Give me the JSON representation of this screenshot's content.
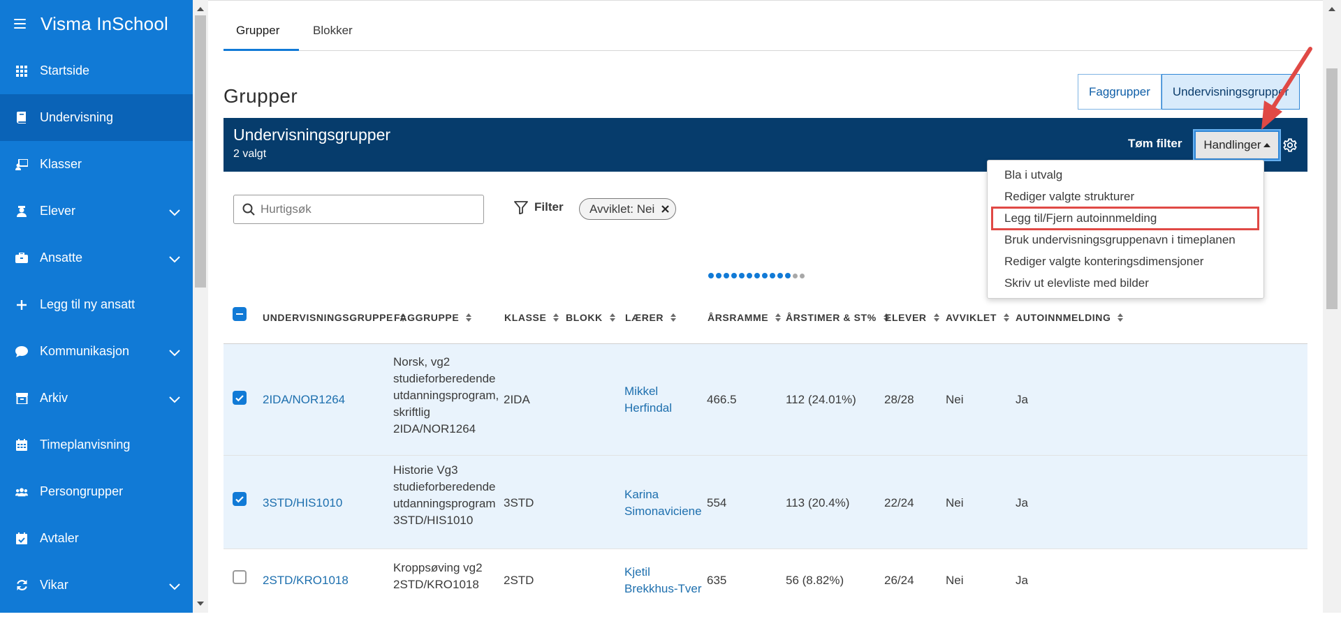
{
  "app": {
    "title": "Visma InSchool"
  },
  "sidebar": {
    "items": [
      {
        "label": "Startside",
        "icon": "grid-icon"
      },
      {
        "label": "Undervisning",
        "icon": "book-icon",
        "active": true
      },
      {
        "label": "Klasser",
        "icon": "classroom-icon"
      },
      {
        "label": "Elever",
        "icon": "student-icon",
        "expandable": true
      },
      {
        "label": "Ansatte",
        "icon": "briefcase-icon",
        "expandable": true
      },
      {
        "label": "Legg til ny ansatt",
        "icon": "plus-icon"
      },
      {
        "label": "Kommunikasjon",
        "icon": "chat-icon",
        "expandable": true
      },
      {
        "label": "Arkiv",
        "icon": "archive-icon",
        "expandable": true
      },
      {
        "label": "Timeplanvisning",
        "icon": "calendar-icon"
      },
      {
        "label": "Persongrupper",
        "icon": "people-icon"
      },
      {
        "label": "Avtaler",
        "icon": "calendar-check-icon"
      },
      {
        "label": "Vikar",
        "icon": "refresh-icon",
        "expandable": true
      }
    ]
  },
  "tabs": [
    {
      "label": "Grupper",
      "active": true
    },
    {
      "label": "Blokker"
    }
  ],
  "page": {
    "title": "Grupper"
  },
  "segmented": {
    "option1": "Faggrupper",
    "option2": "Undervisningsgrupper",
    "selected": "Undervisningsgrupper"
  },
  "grid": {
    "title": "Undervisningsgrupper",
    "subtitle": "2 valgt",
    "clear_filter": "Tøm filter",
    "actions": "Handlinger",
    "search_placeholder": "Hurtigsøk",
    "filter_label": "Filter",
    "chip": "Avviklet: Nei",
    "columns": [
      "UNDERVISNINGSGRUPPE",
      "FAGGRUPPE",
      "KLASSE",
      "BLOKK",
      "LÆRER",
      "ÅRSRAMME",
      "ÅRSTIMER & ST%",
      "ELEVER",
      "AVVIKLET",
      "AUTOINNMELDING"
    ],
    "rows": [
      {
        "selected": true,
        "group": "2IDA/NOR1264",
        "subject_lines": [
          "Norsk, vg2",
          "studieforberedende",
          "utdanningsprogram,",
          "skriftlig",
          "2IDA/NOR1264"
        ],
        "class": "2IDA",
        "block": "",
        "teacher_lines": [
          "Mikkel",
          "Herfindal"
        ],
        "frame": "466.5",
        "hours": "112 (24.01%)",
        "students": "28/28",
        "discontinued": "Nei",
        "auto": "Ja"
      },
      {
        "selected": true,
        "group": "3STD/HIS1010",
        "subject_lines": [
          "Historie Vg3",
          "studieforberedende",
          "utdanningsprogram",
          "3STD/HIS1010"
        ],
        "class": "3STD",
        "block": "",
        "teacher_lines": [
          "Karina",
          "Simonaviciene"
        ],
        "frame": "554",
        "hours": "113 (20.4%)",
        "students": "22/24",
        "discontinued": "Nei",
        "auto": "Ja"
      },
      {
        "selected": false,
        "group": "2STD/KRO1018",
        "subject_lines": [
          "Kroppsøving vg2",
          "2STD/KRO1018"
        ],
        "class": "2STD",
        "block": "",
        "teacher_lines": [
          "Kjetil",
          "Brekkhus-Tver"
        ],
        "frame": "635",
        "hours": "56 (8.82%)",
        "students": "26/24",
        "discontinued": "Nei",
        "auto": "Ja"
      }
    ]
  },
  "dropdown": {
    "items": [
      "Bla i utvalg",
      "Rediger valgte strukturer",
      "Legg til/Fjern autoinnmelding",
      "Bruk undervisningsgruppenavn i timeplanen",
      "Rediger valgte konteringsdimensjoner",
      "Skriv ut elevliste med bilder"
    ],
    "highlighted_index": 2
  },
  "colors": {
    "sidebar": "#117ad6",
    "sidebar_active": "#0a63b7",
    "header": "#063c6c",
    "annotation": "#e04945"
  }
}
